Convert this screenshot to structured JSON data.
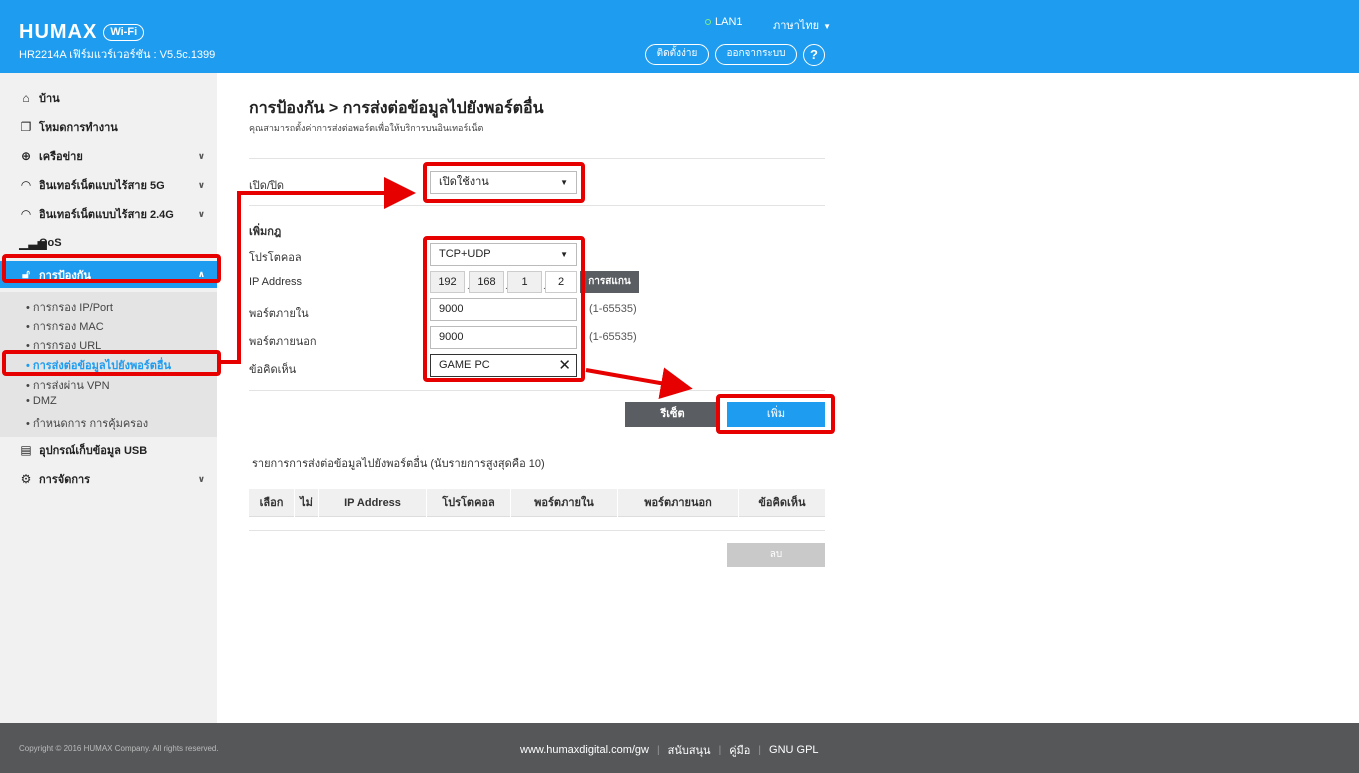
{
  "header": {
    "brand": "HUMAX",
    "brand_badge": "Wi-Fi",
    "model": "HR2214A เฟิร์มแวร์เวอร์ชัน : V5.5c.1399",
    "lan_status": "LAN1",
    "language": "ภาษาไทย",
    "easy_setup": "ติดตั้งง่าย",
    "logout": "ออกจากระบบ",
    "help": "?"
  },
  "sidebar": {
    "items": [
      {
        "label": "บ้าน",
        "icon": "home-icon"
      },
      {
        "label": "โหมดการทำงาน",
        "icon": "mode-icon"
      },
      {
        "label": "เครือข่าย",
        "icon": "globe-icon"
      },
      {
        "label": "อินเทอร์เน็ตแบบไร้สาย 5G",
        "icon": "wifi-icon"
      },
      {
        "label": "อินเทอร์เน็ตแบบไร้สาย 2.4G",
        "icon": "wifi-icon"
      },
      {
        "label": "QoS",
        "icon": "bar-chart-icon"
      },
      {
        "label": "การป้องกัน",
        "icon": "lock-icon"
      },
      {
        "label": "อุปกรณ์เก็บข้อมูล USB",
        "icon": "usb-storage-icon"
      },
      {
        "label": "การจัดการ",
        "icon": "gear-icon"
      }
    ],
    "security_sub": [
      "การกรอง IP/Port",
      "การกรอง MAC",
      "การกรอง URL",
      "การส่งต่อข้อมูลไปยังพอร์ตอื่น",
      "การส่งผ่าน VPN",
      "DMZ",
      "กำหนดการ การคุ้มครอง"
    ]
  },
  "main": {
    "title": "การป้องกัน > การส่งต่อข้อมูลไปยังพอร์ตอื่น",
    "description": "คุณสามารถตั้งค่าการส่งต่อพอร์ตเพื่อให้บริการบนอินเทอร์เน็ต",
    "enable_label": "เปิด/ปิด",
    "enable_value": "เปิดใช้งาน",
    "add_rule_label": "เพิ่มกฎ",
    "protocol_label": "โปรโตคอล",
    "protocol_value": "TCP+UDP",
    "ip_label": "IP Address",
    "ip": [
      "192",
      "168",
      "1",
      "2"
    ],
    "scan_button": "การสแกน",
    "internal_port_label": "พอร์ตภายใน",
    "internal_port_value": "9000",
    "internal_port_range": "(1-65535)",
    "external_port_label": "พอร์ตภายนอก",
    "external_port_value": "9000",
    "external_port_range": "(1-65535)",
    "comment_label": "ข้อคิดเห็น",
    "comment_value": "GAME PC",
    "reset_button": "รีเซ็ต",
    "add_button": "เพิ่ม",
    "list_title": "รายการการส่งต่อข้อมูลไปยังพอร์ตอื่น  (นับรายการสูงสุดคือ 10)",
    "table_headers": [
      "เลือก",
      "ไม่",
      "IP Address",
      "โปรโตคอล",
      "พอร์ตภายใน",
      "พอร์ตภายนอก",
      "ข้อคิดเห็น"
    ],
    "delete_button": "ลบ"
  },
  "footer": {
    "copyright": "Copyright © 2016 HUMAX Company. All rights reserved.",
    "site": "www.humaxdigital.com/gw",
    "support": "สนับสนุน",
    "manual": "คู่มือ",
    "gpl": "GNU GPL"
  },
  "colors": {
    "brand_blue": "#1e9cf0",
    "annotation_red": "#e60000",
    "footer_gray": "#555759"
  }
}
